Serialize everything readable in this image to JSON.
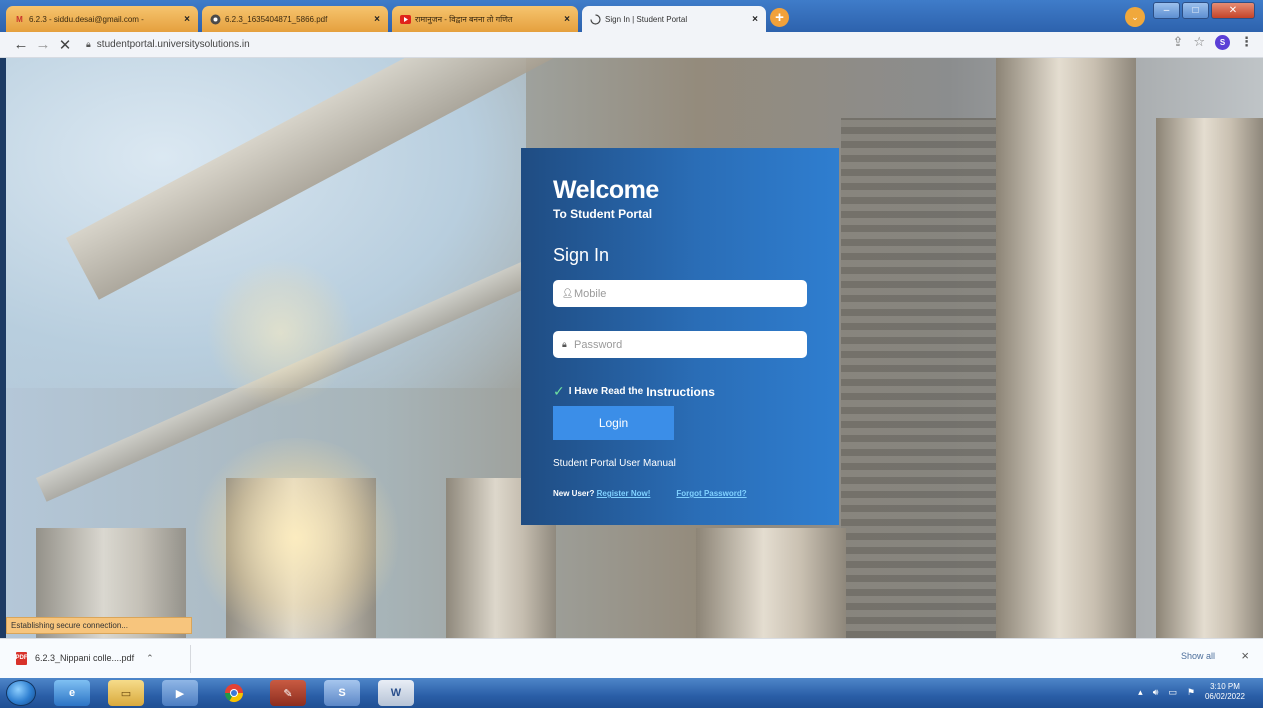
{
  "browser": {
    "tabs": [
      {
        "label": "6.2.3 - siddu.desai@gmail.com -",
        "icon": "gmail-icon",
        "active": false
      },
      {
        "label": "6.2.3_1635404871_5866.pdf",
        "icon": "chrome-icon",
        "active": false
      },
      {
        "label": "रामानुजन - विद्वान बनना तो गणित",
        "icon": "youtube-icon",
        "active": false
      },
      {
        "label": "Sign In | Student Portal",
        "icon": "loading-icon",
        "active": true
      }
    ],
    "close_glyph": "×",
    "new_tab_glyph": "+",
    "url": "studentportal.universitysolutions.in",
    "profile_initial": "S"
  },
  "login": {
    "title": "Welcome",
    "subtitle": "To Student Portal",
    "heading": "Sign In",
    "mobile_placeholder": "Mobile",
    "password_placeholder": "Password",
    "agree_text": "I Have Read the",
    "instructions_link": "Instructions",
    "login_button": "Login",
    "manual_link": "Student Portal User Manual",
    "new_user_text": "New User?",
    "register_link": "Register Now!",
    "forgot_link": "Forgot Password?"
  },
  "status": {
    "text": "Establishing secure connection..."
  },
  "downloads": {
    "file_name": "6.2.3_Nippani colle....pdf",
    "show_all": "Show all",
    "close_glyph": "×"
  },
  "taskbar": {
    "time": "3:10 PM",
    "date": "06/02/2022"
  },
  "colors": {
    "card_start": "#1f4c82",
    "card_end": "#2f7ed0",
    "login_button": "#3b8ee8",
    "link": "#7fd0ff",
    "tab_inactive": "#f2b558"
  }
}
